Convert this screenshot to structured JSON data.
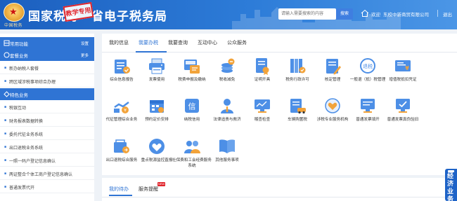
{
  "header": {
    "title_a": "国家税务",
    "title_b": "省电子税务局",
    "stamp": "教学专用",
    "search_placeholder": "请输入需要搜索的内容",
    "search_button": "搜索",
    "welcome": "欢迎",
    "company": "东校中新商贸有限公司",
    "logout": "退出"
  },
  "sidebar": {
    "common": {
      "title": "常用功能",
      "action": "设置"
    },
    "bundle": {
      "title": "套餐业务",
      "action": "更多"
    },
    "bundle_items": [
      {
        "label": "新办纳税人套餐"
      },
      {
        "label": "跨区域涉税事项综合办理"
      }
    ],
    "special": {
      "title": "特色业务"
    },
    "special_items": [
      {
        "label": "税银互动"
      },
      {
        "label": "财务报表数据转换"
      },
      {
        "label": "委托代征业务系统"
      },
      {
        "label": "出口退税业务系统"
      },
      {
        "label": "一照一码户登记信息确认"
      },
      {
        "label": "两证整合个体工商户登记信息确认"
      },
      {
        "label": "普通发票代开"
      }
    ]
  },
  "main": {
    "tabs": [
      {
        "label": "我的信息"
      },
      {
        "label": "我要办税"
      },
      {
        "label": "我要查询"
      },
      {
        "label": "互动中心"
      },
      {
        "label": "公众服务"
      }
    ],
    "active_tab": "我要办税",
    "tiles": [
      {
        "label": "综合信息报告",
        "icon": "info-report-icon"
      },
      {
        "label": "发票使用",
        "icon": "invoice-printer-icon"
      },
      {
        "label": "税费申报及缴纳",
        "icon": "tax-declare-icon"
      },
      {
        "label": "税收减免",
        "icon": "tax-reduction-icon"
      },
      {
        "label": "证明开具",
        "icon": "certificate-icon"
      },
      {
        "label": "税务行政许可",
        "icon": "admin-license-icon"
      },
      {
        "label": "核定管理",
        "icon": "assessment-icon"
      },
      {
        "label": "一般退（抵）税管理",
        "icon": "tax-refund-icon"
      },
      {
        "label": "增值税抵扣凭证",
        "icon": "vat-voucher-icon"
      },
      {
        "label": "代征管理综合业务",
        "icon": "collection-icon"
      },
      {
        "label": "预约定价安排",
        "icon": "pricing-calendar-icon"
      },
      {
        "label": "纳税信用",
        "icon": "tax-credit-icon"
      },
      {
        "label": "法律追责与救济",
        "icon": "legal-icon"
      },
      {
        "label": "稽查检查",
        "icon": "inspection-icon"
      },
      {
        "label": "车辆购置税",
        "icon": "vehicle-tax-icon"
      },
      {
        "label": "涉税专业服务机构",
        "icon": "agency-heart-icon"
      },
      {
        "label": "普通发票填开",
        "icon": "invoice-fill-icon"
      },
      {
        "label": "普通发票真伪验旧",
        "icon": "invoice-verify-icon"
      },
      {
        "label": "出口退税综合服务",
        "icon": "export-refund-icon"
      },
      {
        "label": "重点税源监控直报",
        "icon": "key-source-icon"
      },
      {
        "label": "社保费和工会经费服务系统",
        "icon": "social-security-icon"
      },
      {
        "label": "其他服务事项",
        "icon": "other-services-icon"
      }
    ]
  },
  "bottom": {
    "tabs": [
      {
        "label": "我的待办"
      },
      {
        "label": "服务提醒"
      }
    ],
    "badge": "NEW"
  },
  "float_button": {
    "label": "经济业务"
  },
  "colors": {
    "header_blue": "#1c5fbf",
    "accent": "#2f74d4",
    "stamp_red": "#e0242b"
  }
}
